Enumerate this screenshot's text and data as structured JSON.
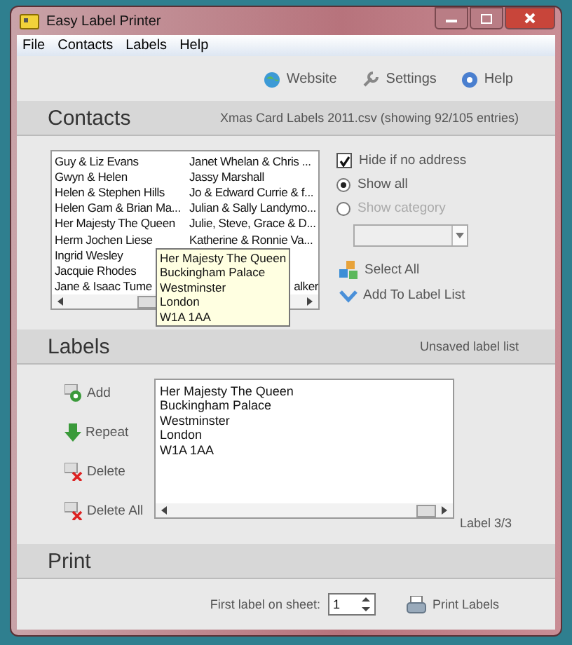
{
  "window": {
    "title": "Easy Label Printer"
  },
  "menu": [
    "File",
    "Contacts",
    "Labels",
    "Help"
  ],
  "toolbar": [
    {
      "kind": "globe",
      "label": "Website"
    },
    {
      "kind": "wrench",
      "label": "Settings"
    },
    {
      "kind": "help",
      "label": "Help"
    }
  ],
  "contacts": {
    "title": "Contacts",
    "file_info": "Xmas Card Labels 2011.csv (showing 92/105 entries)",
    "rows": [
      {
        "column_1": "Guy & Liz Evans",
        "column_2": "Janet Whelan & Chris ..."
      },
      {
        "column_1": "Gwyn & Helen",
        "column_2": "Jassy Marshall"
      },
      {
        "column_1": "Helen & Stephen Hills",
        "column_2": "Jo & Edward Currie & f..."
      },
      {
        "column_1": "Helen Gam & Brian Ma...",
        "column_2": "Julian & Sally Landymo..."
      },
      {
        "column_1": "Her Majesty The Queen",
        "column_2": "Julie, Steve, Grace & D..."
      },
      {
        "column_1": "Herm Jochen Liese",
        "column_2": "Katherine & Ronnie Va..."
      },
      {
        "column_1": "Ingrid Wesley"
      },
      {
        "column_1": "Jacquie Rhodes"
      },
      {
        "column_1": "Jane & Isaac Tume",
        "column_2": "alker"
      }
    ],
    "tooltip": [
      "Her Majesty The Queen",
      "Buckingham Palace",
      "Westminster",
      "London",
      "W1A 1AA"
    ],
    "hide_if_no_address": {
      "label": "Hide if no address",
      "checked": true
    },
    "filters": [
      {
        "label": "Show all",
        "selected": true,
        "disabled": false
      },
      {
        "label": "Show category",
        "selected": false,
        "disabled": true
      }
    ],
    "actions": [
      {
        "kind": "select",
        "label": "Select All"
      },
      {
        "kind": "add",
        "label": "Add To Label List"
      }
    ]
  },
  "labels": {
    "title": "Labels",
    "status": "Unsaved label list",
    "actions": [
      {
        "kind": "add",
        "label": "Add"
      },
      {
        "kind": "repeat",
        "label": "Repeat"
      },
      {
        "kind": "delete",
        "label": "Delete"
      },
      {
        "kind": "delete",
        "label": "Delete All"
      }
    ],
    "lines": [
      "Her Majesty The Queen",
      "Buckingham Palace",
      "Westminster",
      "London",
      "W1A 1AA"
    ],
    "counter": "Label 3/3"
  },
  "print": {
    "title": "Print",
    "first_label": {
      "label": "First label on sheet:",
      "value": "1"
    },
    "button": "Print Labels"
  }
}
